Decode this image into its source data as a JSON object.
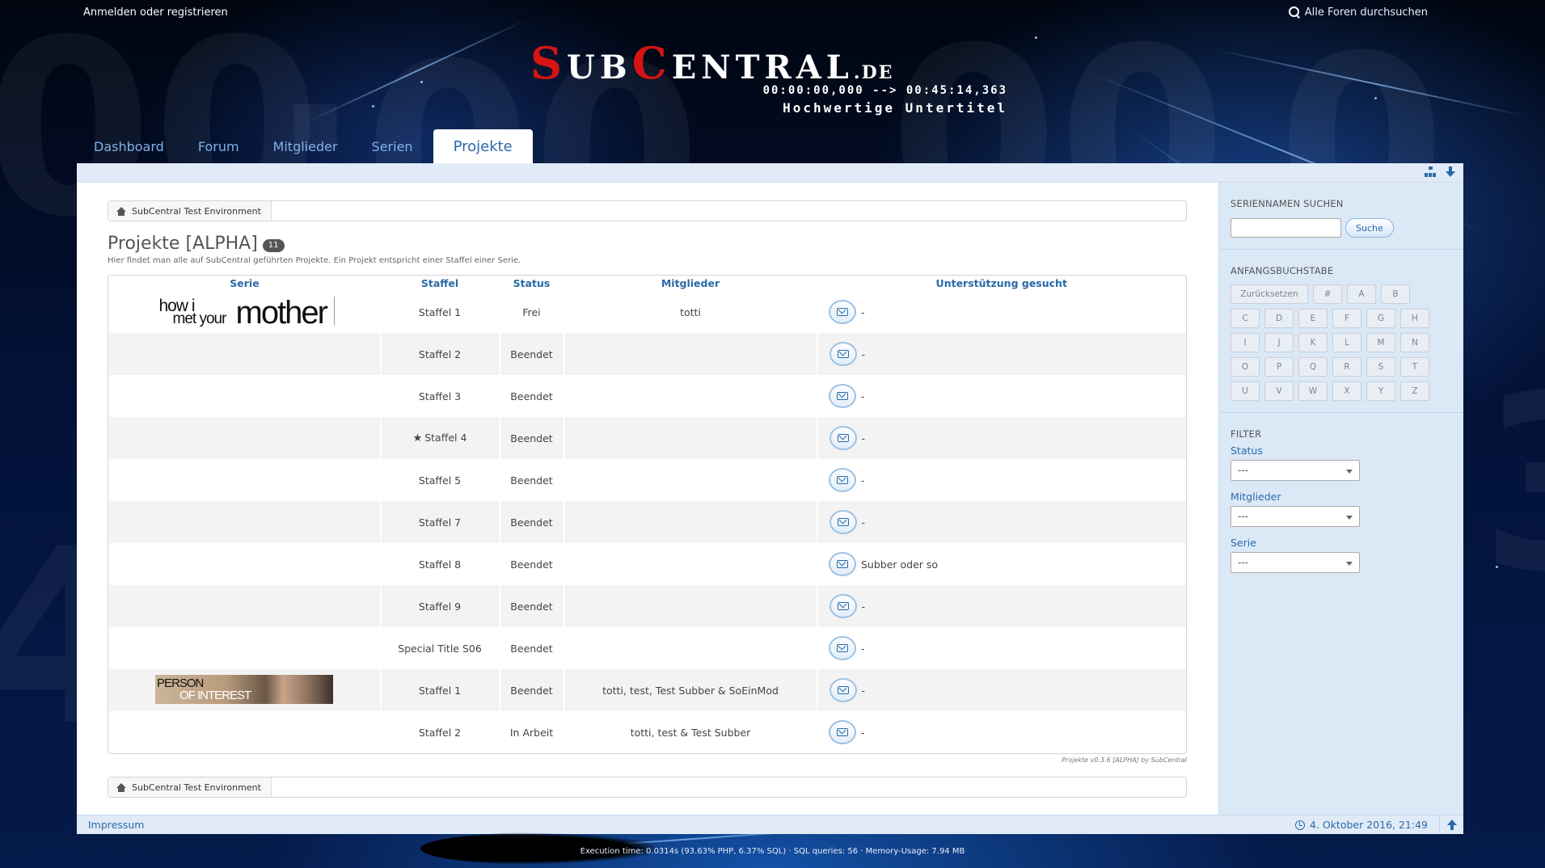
{
  "topbar": {
    "login": "Anmelden oder registrieren",
    "search_all": "Alle Foren durchsuchen"
  },
  "logo": {
    "brand_s": "S",
    "brand_ub": "UB",
    "brand_c": "C",
    "brand_entral": "ENTRAL",
    "brand_tld": ".DE",
    "timecode": "00:00:00,000 --> 00:45:14,363",
    "tagline": "Hochwertige Untertitel"
  },
  "nav": {
    "tabs": [
      {
        "label": "Dashboard"
      },
      {
        "label": "Forum"
      },
      {
        "label": "Mitglieder"
      },
      {
        "label": "Serien"
      },
      {
        "label": "Projekte"
      }
    ],
    "active": "Projekte"
  },
  "breadcrumb": {
    "item": "SubCentral Test Environment"
  },
  "page": {
    "title": "Projekte [ALPHA]",
    "count": "11",
    "description": "Hier findet man alle auf SubCentral geführten Projekte. Ein Projekt entspricht einer Staffel einer Serie."
  },
  "table": {
    "headers": [
      "Serie",
      "Staffel",
      "Status",
      "Mitglieder",
      "Unterstützung gesucht"
    ],
    "rows": [
      {
        "staffel": "Staffel 1",
        "status": "Frei",
        "mitglieder": "totti",
        "support": "-"
      },
      {
        "staffel": "Staffel 2",
        "status": "Beendet",
        "mitglieder": "",
        "support": "-"
      },
      {
        "staffel": "Staffel 3",
        "status": "Beendet",
        "mitglieder": "",
        "support": "-"
      },
      {
        "staffel": "Staffel 4",
        "status": "Beendet",
        "mitglieder": "",
        "support": "-"
      },
      {
        "staffel": "Staffel 5",
        "status": "Beendet",
        "mitglieder": "",
        "support": "-"
      },
      {
        "staffel": "Staffel 7",
        "status": "Beendet",
        "mitglieder": "",
        "support": "-"
      },
      {
        "staffel": "Staffel 8",
        "status": "Beendet",
        "mitglieder": "",
        "support": "Subber oder so"
      },
      {
        "staffel": "Staffel 9",
        "status": "Beendet",
        "mitglieder": "",
        "support": "-"
      },
      {
        "staffel": "Special Title S06",
        "status": "Beendet",
        "mitglieder": "",
        "support": "-"
      },
      {
        "staffel": "Staffel 1",
        "status": "Beendet",
        "mitglieder": "totti, test, Test Subber & SoEinMod",
        "support": "-"
      },
      {
        "staffel": "Staffel 2",
        "status": "In Arbeit",
        "mitglieder": "totti, test & Test Subber",
        "support": "-"
      }
    ]
  },
  "series_logos": {
    "himym_line1": "how i",
    "himym_line2": "met your",
    "himym_big": "mother",
    "poi_line1": "PERSON",
    "poi_line2": "OF INTEREST"
  },
  "version": "Projekte v0.3.6 [ALPHA] by SubCentral",
  "sidebar": {
    "search_title": "SERIENNAMEN SUCHEN",
    "search_input_value": "",
    "search_button": "Suche",
    "letters_title": "ANFANGSBUCHSTABE",
    "letters": [
      "Zurücksetzen",
      "#",
      "A",
      "B",
      "C",
      "D",
      "E",
      "F",
      "G",
      "H",
      "I",
      "J",
      "K",
      "L",
      "M",
      "N",
      "O",
      "P",
      "Q",
      "R",
      "S",
      "T",
      "U",
      "V",
      "W",
      "X",
      "Y",
      "Z"
    ],
    "filter_title": "FILTER",
    "filters": [
      {
        "label": "Status",
        "value": "---"
      },
      {
        "label": "Mitglieder",
        "value": "---"
      },
      {
        "label": "Serie",
        "value": "---"
      }
    ]
  },
  "footer": {
    "impressum": "Impressum",
    "date": "4. Oktober 2016, 21:49"
  },
  "exec_info": "Execution time: 0.0314s (93.63% PHP, 6.37% SQL) · SQL queries: 56 · Memory-Usage: 7.94 MB"
}
